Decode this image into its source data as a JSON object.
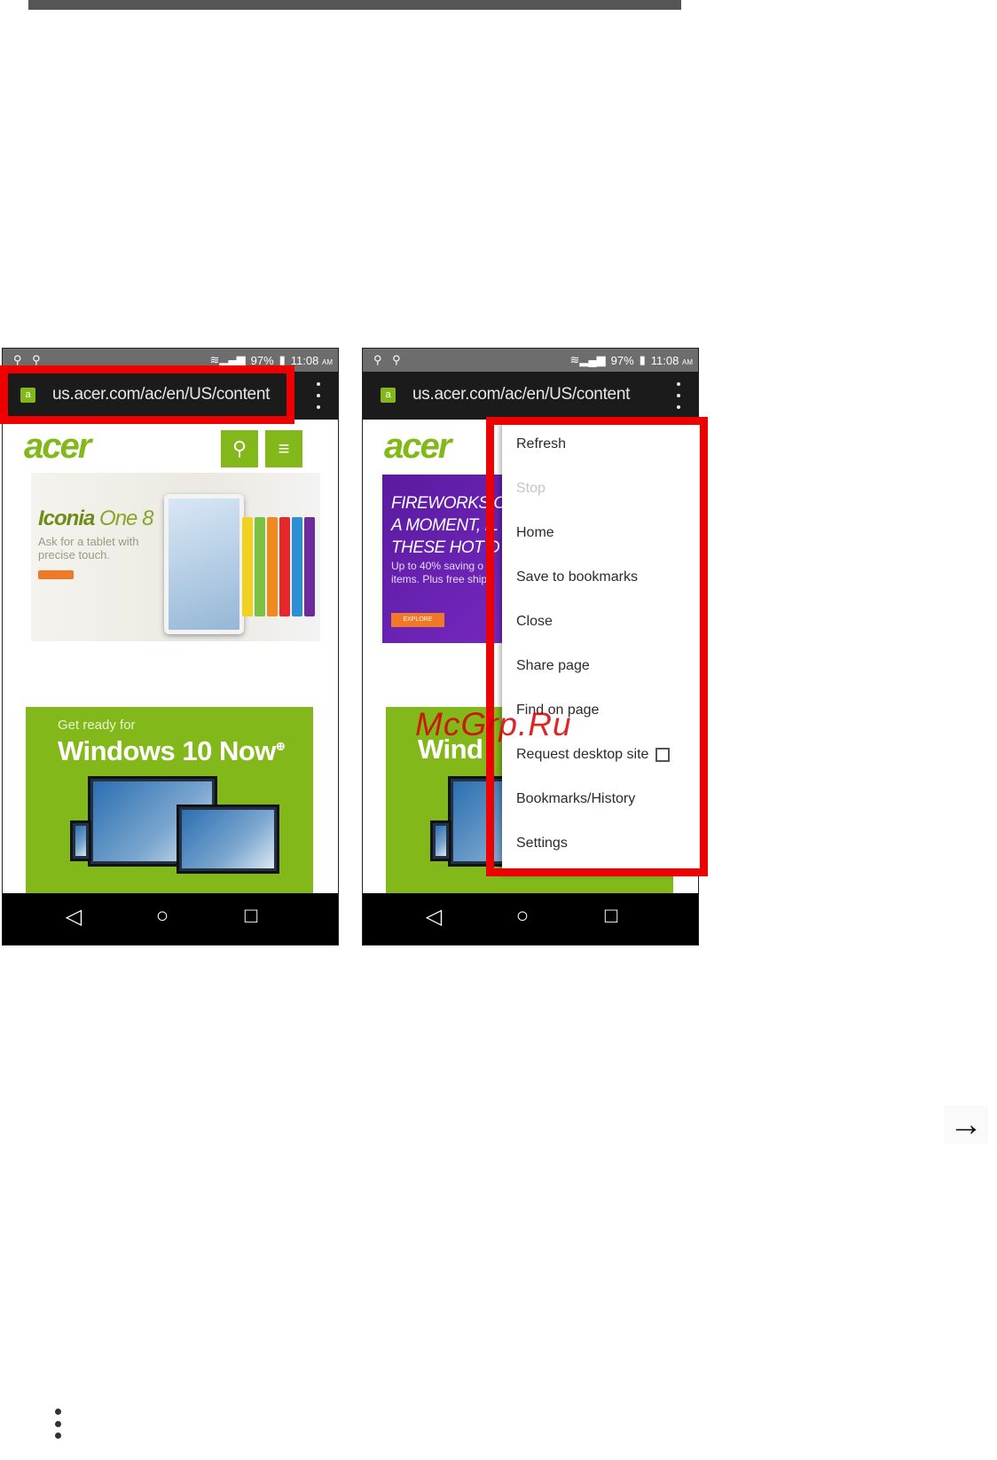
{
  "status_bar": {
    "left_icons": "⚲ ⚲",
    "signal": "≋▂▄▆",
    "battery": "97%",
    "battery_icon": "▮",
    "time": "11:08",
    "ampm": "AM"
  },
  "browser": {
    "favicon": "a",
    "url": "us.acer.com/ac/en/US/content",
    "menu_icon": "kebab-menu-icon"
  },
  "site": {
    "logo": "acer",
    "search_glyph": "⚲",
    "menu_glyph": "≡",
    "iconia_title": "Iconia",
    "iconia_title_suffix": "One 8",
    "iconia_subtitle": "Ask for a tablet with precise touch.",
    "win_small": "Get ready for",
    "win_big": "Windows 10 Now",
    "win_big_suffix": "⊕",
    "promo_lines": "FIREWORKS C\nA MOMENT, IL\nTHESE HOT D",
    "promo_sub": "Up to 40% saving o\nitems. Plus free ship",
    "promo_btn": "EXPLORE",
    "win_partial": "Wind"
  },
  "menu": {
    "items": [
      {
        "label": "Refresh",
        "enabled": true
      },
      {
        "label": "Stop",
        "enabled": false
      },
      {
        "label": "Home",
        "enabled": true
      },
      {
        "label": "Save to bookmarks",
        "enabled": true
      },
      {
        "label": "Close",
        "enabled": true
      },
      {
        "label": "Share page",
        "enabled": true
      },
      {
        "label": "Find on page",
        "enabled": true
      },
      {
        "label": "Request desktop site",
        "enabled": true,
        "checkbox": false
      },
      {
        "label": "Bookmarks/History",
        "enabled": true
      },
      {
        "label": "Settings",
        "enabled": true
      }
    ]
  },
  "nav": {
    "back": "◁",
    "home": "○",
    "recents": "□"
  },
  "watermark": "McGrp.Ru",
  "page_arrow": "→",
  "colors": {
    "highlight": "#ee0000",
    "acer_green": "#83b81a",
    "promo_purple": "#6a22b4",
    "cta_orange": "#f07826"
  }
}
